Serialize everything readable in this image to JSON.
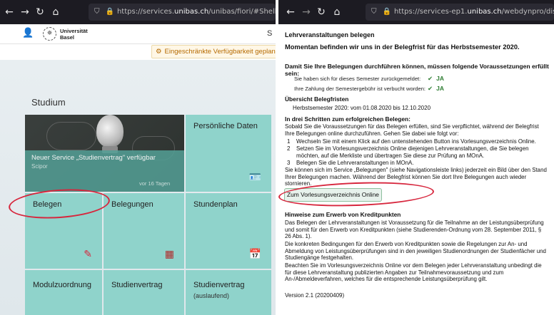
{
  "left": {
    "url": {
      "prefix": "https://services.",
      "host": "unibas.ch",
      "suffix": "/unibas/fiori/#Shell-home"
    },
    "logo_text_line1": "Universität",
    "logo_text_line2": "Basel",
    "header_letter": "S",
    "notice": "Eingeschränkte Verfügbarkeit geplan",
    "section_title": "Studium",
    "news_tile": {
      "title": "Neuer Service „Studienvertrag\" verfügbar",
      "subtitle": "Scipor",
      "footer": "vor 16 Tagen"
    },
    "tiles": {
      "persoenliche": "Persönliche Daten",
      "belegen": "Belegen",
      "belegungen": "Belegungen",
      "stundenplan": "Stundenplan",
      "modulzuordnung": "Modulzuordnung",
      "studienvertrag": "Studienvertrag",
      "studienvertrag_ausl": "Studienvertrag",
      "studienvertrag_ausl_sub": "(auslaufend)"
    }
  },
  "right": {
    "url": {
      "prefix": "https://services-ep1.",
      "host": "unibas.ch",
      "suffix": "/webdynpro/dispatcher/local/"
    },
    "title": "Lehrveranstaltungen belegen",
    "phase": "Momentan befinden wir uns in der Belegfrist für das Herbstsemester 2020.",
    "prereq_heading": "Damit Sie Ihre Belegungen durchführen können, müssen folgende Voraussetzungen erfüllt sein:",
    "conditions": [
      {
        "label": "Sie haben sich für dieses Semester zurückgemeldet:",
        "value": "JA"
      },
      {
        "label": "Ihre Zahlung der Semestergebühr ist verbucht worden:",
        "value": "JA"
      }
    ],
    "fristen_heading": "Übersicht Belegfristen",
    "fristen_line": "Herbstsemester 2020: vom 01.08.2020 bis 12.10.2020",
    "steps_heading": "In drei Schritten zum erfolgreichen Belegen:",
    "steps_intro": "Sobald Sie die Voraussetzungen für das Belegen erfüllen, sind Sie verpflichtet, während der Belegfrist Ihre Belegungen online durchzuführen. Gehen Sie dabei wie folgt vor:",
    "steps": [
      {
        "num": "1",
        "line1": "Wechseln Sie mit einem Klick auf den untenstehenden Button ins Vorlesungsverzeichnis Online.",
        "line2": ""
      },
      {
        "num": "2",
        "line1": "Setzen Sie im Vorlesungsverzeichnis Online diejenigen Lehrveranstaltungen, die Sie belegen",
        "line2": "möchten, auf die Merkliste und übertragen Sie diese zur Prüfung an MOnA."
      },
      {
        "num": "3",
        "line1": "Belegen Sie die Lehrveranstaltungen in MOnA.",
        "line2": ""
      }
    ],
    "service_note": "Sie können sich im Service „Belegungen\" (siehe Navigationsleiste links) jederzeit ein Bild über den Stand Ihrer Belegungen machen. Während der Belegfrist können Sie dort Ihre Belegungen auch wieder stornieren.",
    "cta_button": "Zum Vorlesungsverzeichnis Online",
    "credits_heading": "Hinweise zum Erwerb von Kreditpunkten",
    "credits_p1": "Das Belegen der Lehrveranstaltungen ist Voraussetzung für die Teilnahme an der Leistungsüberprüfung und somit für den Erwerb von Kreditpunkten (siehe Studierenden-Ordnung vom 28. September 2011, § 26 Abs. 1).",
    "credits_p2": "Die konkreten Bedingungen für den Erwerb von Kreditpunkten sowie die Regelungen zur An- und Abmeldung von Leistungsüberprüfungen sind in den jeweiligen Studienordnungen der Studienfächer und Studiengänge festgehalten.",
    "credits_p3": "Beachten Sie im Vorlesungsverzeichnis Online vor dem Belegen jeder Lehrveranstaltung unbedingt die für diese Lehrveranstaltung publizierten Angaben zur Teilnahmevoraussetzung und zum An-/Abmeldeverfahren, welches für die entsprechende Leistungsüberprüfung gilt.",
    "version": "Version 2.1 (20200409)"
  },
  "icons": [
    "back-icon",
    "forward-icon",
    "reload-icon",
    "home-icon",
    "shield-icon",
    "lock-icon",
    "user-icon",
    "gear-icon",
    "id-card-icon",
    "pencil-icon",
    "grid-icon",
    "calendar-icon",
    "checkmark-icon"
  ],
  "colors": {
    "tile": "#8fd3cb",
    "toolbar": "#1c1b22",
    "annotation": "#d7263d",
    "check": "#2e7d32",
    "notice_text": "#b56a00"
  }
}
